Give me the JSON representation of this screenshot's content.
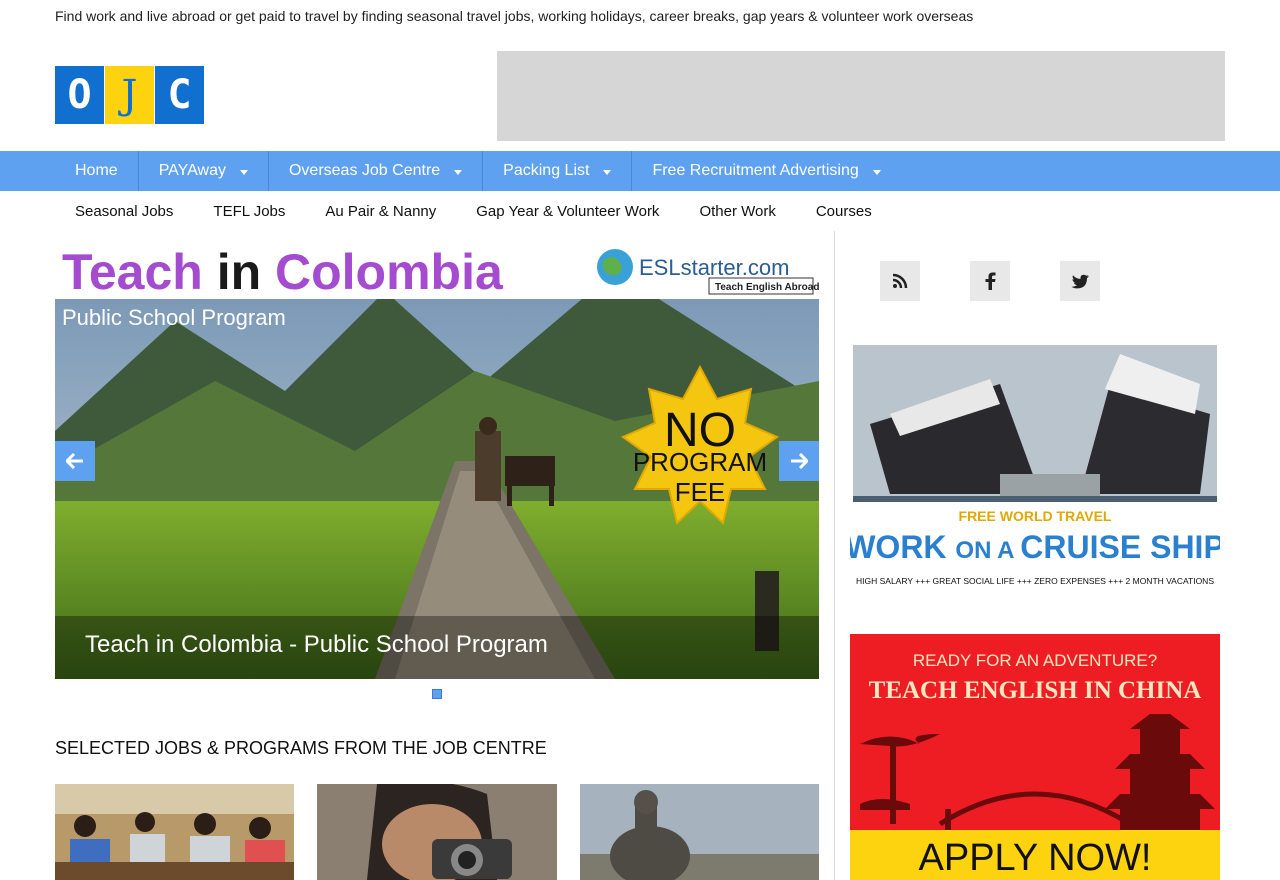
{
  "tagline": "Find work and live abroad or get paid to travel by finding seasonal travel jobs, working holidays, career breaks, gap years & volunteer work overseas",
  "logo": {
    "letters": [
      "O",
      "J",
      "C"
    ],
    "colors": {
      "blue": "#1170cf",
      "yellow": "#fdd20e"
    }
  },
  "main_nav": {
    "items": [
      {
        "label": "Home",
        "dropdown": false
      },
      {
        "label": "PAYAway",
        "dropdown": true
      },
      {
        "label": "Overseas Job Centre",
        "dropdown": true
      },
      {
        "label": "Packing List",
        "dropdown": true
      },
      {
        "label": "Free Recruitment Advertising",
        "dropdown": true
      }
    ],
    "color": "#5ea1f0"
  },
  "sub_nav": {
    "items": [
      "Seasonal Jobs",
      "TEFL Jobs",
      "Au Pair & Nanny",
      "Gap Year & Volunteer Work",
      "Other Work",
      "Courses"
    ]
  },
  "slider": {
    "banner_title_part1": "Teach ",
    "banner_title_in": "in",
    "banner_title_part2": " Colombia",
    "banner_subtitle": "Public School Program",
    "brand": "ESLstarter.com",
    "brand_tag": "Teach English Abroad",
    "badge_line1": "NO",
    "badge_line2": "PROGRAM",
    "badge_line3": "FEE",
    "caption": "Teach in Colombia - Public School Program",
    "prev_icon": "arrow-left-icon",
    "next_icon": "arrow-right-icon"
  },
  "section": {
    "title": "SELECTED JOBS & PROGRAMS FROM THE JOB CENTRE"
  },
  "social": {
    "icons": [
      "rss-icon",
      "facebook-icon",
      "twitter-icon"
    ]
  },
  "cruise_ad": {
    "line1": "FREE WORLD TRAVEL",
    "line2_a": "WORK ",
    "line2_b": "ON A ",
    "line2_c": "CRUISE SHIP",
    "line3": "HIGH SALARY +++ GREAT SOCIAL LIFE +++ ZERO EXPENSES +++ 2 MONTH VACATIONS"
  },
  "china_ad": {
    "line1": "READY FOR AN ADVENTURE?",
    "line2": "TEACH ENGLISH IN CHINA",
    "cta": "APPLY NOW!"
  }
}
